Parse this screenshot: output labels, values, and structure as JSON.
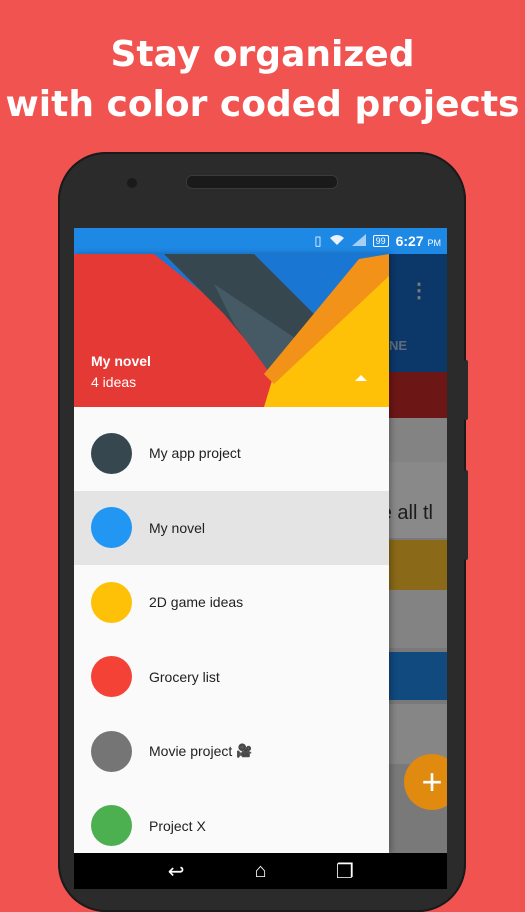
{
  "headline": {
    "line1": "Stay organized",
    "line2": "with color coded projects"
  },
  "status_bar": {
    "battery": "99",
    "time": "6:27",
    "ampm": "PM"
  },
  "app_behind": {
    "tab_partial": "NE",
    "text_partial": "e all tl",
    "fab_label": "+"
  },
  "drawer": {
    "header": {
      "title": "My novel",
      "subtitle": "4 ideas"
    },
    "projects": [
      {
        "label": "My app project",
        "color": "#37474f",
        "selected": false
      },
      {
        "label": "My novel",
        "color": "#2196f3",
        "selected": true
      },
      {
        "label": "2D game ideas",
        "color": "#ffc107",
        "selected": false
      },
      {
        "label": "Grocery list",
        "color": "#f44336",
        "selected": false
      },
      {
        "label": "Movie project",
        "color": "#757575",
        "selected": false,
        "icon": "🎥"
      },
      {
        "label": "Project X",
        "color": "#4caf50",
        "selected": false
      }
    ]
  },
  "nav_bar": {
    "back": "↩",
    "home": "⌂",
    "recents": "❐"
  },
  "colors": {
    "background": "#f05350",
    "status_bar": "#1e88e5",
    "drawer_header_red": "#e53935",
    "accent_yellow": "#ffc107"
  }
}
